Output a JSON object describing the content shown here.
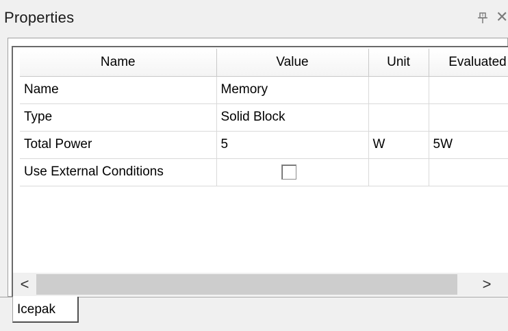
{
  "panel": {
    "title": "Properties",
    "pin_glyph": "⊥",
    "close_glyph": "✕"
  },
  "grid": {
    "columns": [
      "Name",
      "Value",
      "Unit",
      "Evaluated"
    ],
    "rows": [
      {
        "name": "Name",
        "value": "Memory",
        "unit": "",
        "evaluated": ""
      },
      {
        "name": "Type",
        "value": "Solid Block",
        "unit": "",
        "evaluated": ""
      },
      {
        "name": "Total Power",
        "value": "5",
        "unit": "W",
        "evaluated": "5W"
      },
      {
        "name": "Use External Conditions",
        "value_checked": false,
        "unit": "",
        "evaluated": ""
      }
    ]
  },
  "scrollbar": {
    "left_arrow": "<",
    "right_arrow": ">"
  },
  "tabs": [
    {
      "label": "Icepak",
      "active": true
    }
  ],
  "icons": {
    "pin": "pin-icon",
    "close": "close-icon",
    "scroll_left": "chevron-left-icon",
    "scroll_right": "chevron-right-icon"
  }
}
